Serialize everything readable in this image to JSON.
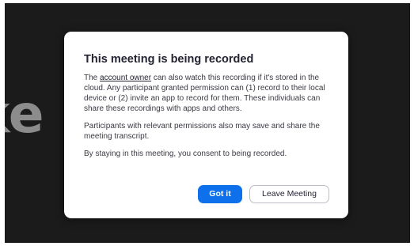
{
  "background": {
    "name_text": "ike ne"
  },
  "dialog": {
    "title": "This meeting is being recorded",
    "para1_link": "account owner",
    "para1_before": "The ",
    "para1_after": " can also watch this recording if it's stored in the cloud. Any participant granted permission can (1) record to their local device or (2) invite an app to record for them. These individuals can share these recordings with apps and others.",
    "para2": "Participants with relevant permissions also may save and share the meeting transcript.",
    "para3": "By staying in this meeting, you consent to being recorded.",
    "primary_button": "Got it",
    "secondary_button": "Leave Meeting"
  },
  "colors": {
    "primary": "#0e71eb",
    "backdrop": "#1b1b1b"
  }
}
